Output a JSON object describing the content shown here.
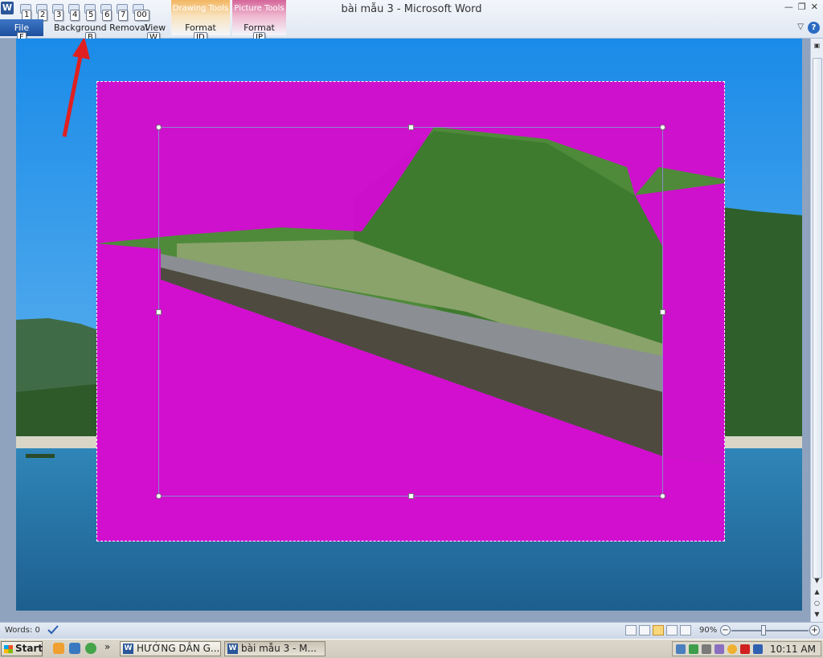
{
  "window": {
    "title": "bài mẫu 3 - Microsoft Word"
  },
  "qat": [
    {
      "name": "save",
      "keytip": "1"
    },
    {
      "name": "undo",
      "keytip": "2"
    },
    {
      "name": "redo",
      "keytip": "3"
    },
    {
      "name": "paste",
      "keytip": "4"
    },
    {
      "name": "font-color",
      "keytip": "5"
    },
    {
      "name": "new",
      "keytip": "6"
    },
    {
      "name": "open",
      "keytip": "7"
    },
    {
      "name": "customize",
      "keytip": "00"
    }
  ],
  "ribbon": {
    "file_tab": {
      "label": "File",
      "keytip": "F"
    },
    "tabs": [
      {
        "label": "Background Removal",
        "keytip": "B"
      },
      {
        "label": "View",
        "keytip": "W"
      }
    ],
    "contextual": [
      {
        "group": "Drawing Tools",
        "tab": "Format",
        "keytip": "JD",
        "color": "#f2b661"
      },
      {
        "group": "Picture Tools",
        "tab": "Format",
        "keytip": "JP",
        "color": "#d4669a"
      }
    ]
  },
  "status": {
    "words": "Words: 0",
    "zoom": "90%",
    "zoom_fraction": 0.42
  },
  "taskbar": {
    "start": "Start",
    "tasks": [
      {
        "label": "HƯỚNG DẪN G...",
        "active": false
      },
      {
        "label": "bài mẫu 3 - M...",
        "active": true
      }
    ],
    "clock": "10:11 AM"
  },
  "colors": {
    "removal_magenta": "#e000e0",
    "annotation_arrow": "#e02020",
    "word_blue": "#2b579a"
  }
}
